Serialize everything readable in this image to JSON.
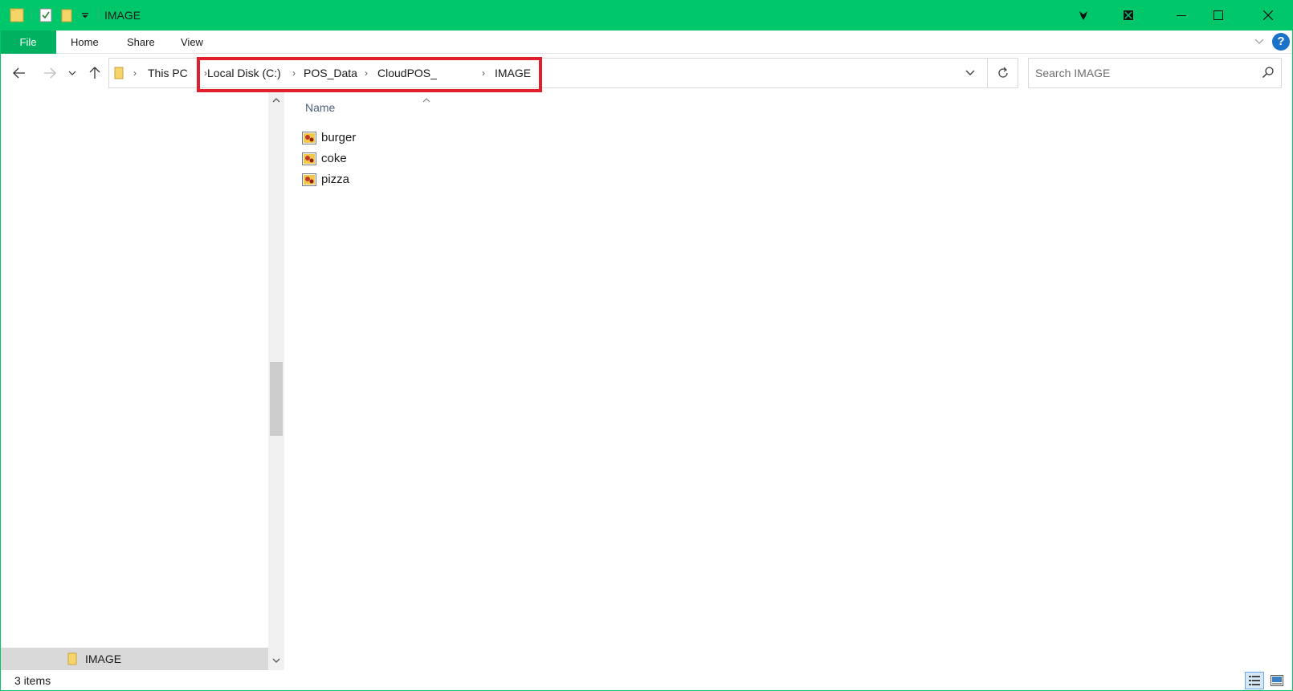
{
  "window": {
    "title": "IMAGE",
    "accent_color": "#00c86a",
    "quick_access_icons": [
      "folder-icon",
      "properties-checkbox-icon",
      "new-folder-icon",
      "customize-dropdown-icon"
    ],
    "controls": [
      "minimize-icon",
      "maximize-icon",
      "close-icon"
    ]
  },
  "ribbon": {
    "file_label": "File",
    "tabs": [
      {
        "label": "Home"
      },
      {
        "label": "Share"
      },
      {
        "label": "View"
      }
    ],
    "help_label": "?"
  },
  "navigation": {
    "breadcrumbs": [
      {
        "label": "This PC"
      },
      {
        "label": "Local Disk (C:)"
      },
      {
        "label": "POS_Data"
      },
      {
        "label": "CloudPOS_"
      },
      {
        "label": "IMAGE"
      }
    ],
    "search_placeholder": "Search IMAGE",
    "highlight_color": "#e11e2b"
  },
  "nav_pane": {
    "selected_item": {
      "label": "IMAGE",
      "icon": "folder-icon"
    }
  },
  "content": {
    "column_header": "Name",
    "files": [
      {
        "name": "burger",
        "icon": "image-file-icon"
      },
      {
        "name": "coke",
        "icon": "image-file-icon"
      },
      {
        "name": "pizza",
        "icon": "image-file-icon"
      }
    ]
  },
  "status": {
    "item_count": "3 items",
    "view_modes": [
      "details-view-icon",
      "large-icons-view-icon"
    ]
  }
}
